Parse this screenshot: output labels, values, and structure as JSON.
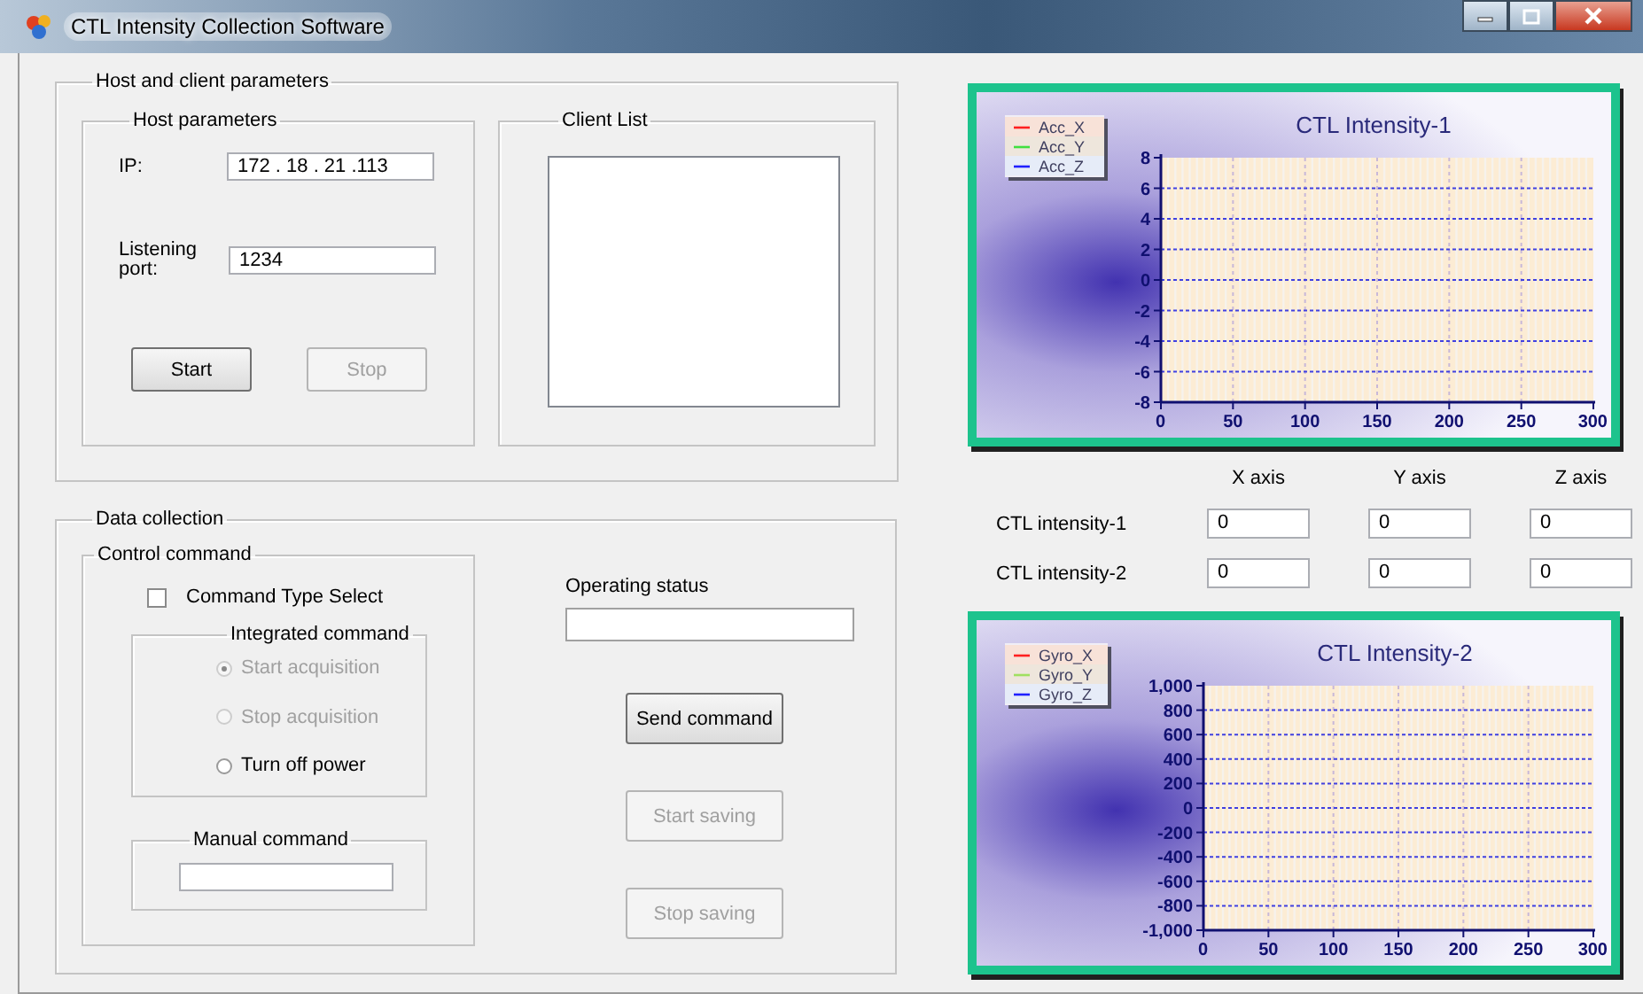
{
  "window": {
    "title": "CTL Intensity Collection Software"
  },
  "host_client": {
    "title": "Host and client parameters",
    "host": {
      "title": "Host parameters",
      "ip_label": "IP:",
      "ip_value": "172 . 18 . 21 .113",
      "port_label": "Listening port:",
      "port_value": "1234",
      "buttons": [
        {
          "label": "Start",
          "disabled": false
        },
        {
          "label": "Stop",
          "disabled": true
        }
      ]
    },
    "client_list": {
      "title": "Client List"
    }
  },
  "data_collection": {
    "title": "Data collection",
    "control_command": {
      "title": "Control command",
      "checkbox": {
        "label": "Command Type Select",
        "checked": false
      },
      "integrated": {
        "title": "Integrated command",
        "options": [
          {
            "label": "Start acquisition",
            "selected": true,
            "disabled": true
          },
          {
            "label": "Stop acquisition",
            "selected": false,
            "disabled": true
          },
          {
            "label": "Turn off power",
            "selected": false,
            "disabled": false
          }
        ]
      },
      "manual": {
        "title": "Manual command"
      }
    },
    "status": {
      "label": "Operating status"
    },
    "buttons": [
      {
        "label": "Send command",
        "disabled": false
      },
      {
        "label": "Start saving",
        "disabled": true
      },
      {
        "label": "Stop saving",
        "disabled": true
      }
    ]
  },
  "charts": [
    {
      "chart_data": {
        "type": "line",
        "title": "CTL Intensity-1",
        "series": [
          {
            "name": "Acc_X",
            "color": "#ff2020",
            "values": [
              null,
              null,
              null,
              null,
              null,
              null,
              null
            ]
          },
          {
            "name": "Acc_Y",
            "color": "#40e040",
            "values": [
              null,
              null,
              null,
              null,
              null,
              null,
              null
            ]
          },
          {
            "name": "Acc_Z",
            "color": "#2020ff",
            "values": [
              null,
              null,
              null,
              null,
              null,
              null,
              null
            ]
          }
        ],
        "categories": [
          "0",
          "50",
          "100",
          "150",
          "200",
          "250",
          "300"
        ],
        "ylim": [
          -8,
          8
        ],
        "yticks": [
          -8,
          -6,
          -4,
          -2,
          0,
          2,
          4,
          6,
          8
        ],
        "grid": true
      }
    },
    {
      "chart_data": {
        "type": "line",
        "title": "CTL Intensity-2",
        "series": [
          {
            "name": "Gyro_X",
            "color": "#ff2020",
            "values": [
              null,
              null,
              null,
              null,
              null,
              null,
              null
            ]
          },
          {
            "name": "Gyro_Y",
            "color": "#a0e060",
            "values": [
              null,
              null,
              null,
              null,
              null,
              null,
              null
            ]
          },
          {
            "name": "Gyro_Z",
            "color": "#2020ff",
            "values": [
              null,
              null,
              null,
              null,
              null,
              null,
              null
            ]
          }
        ],
        "categories": [
          "0",
          "50",
          "100",
          "150",
          "200",
          "250",
          "300"
        ],
        "ylim": [
          -1000,
          1000
        ],
        "grid": true,
        "yticks": [
          {
            "value": -1000,
            "label": "-1,000"
          },
          -800,
          -600,
          -400,
          -200,
          0,
          200,
          400,
          600,
          800,
          {
            "value": 1000,
            "label": "1,000"
          }
        ]
      }
    }
  ],
  "readings": {
    "columns": [
      "X axis",
      "Y axis",
      "Z axis"
    ],
    "rows": [
      {
        "label": "CTL intensity-1",
        "values": [
          "0",
          "0",
          "0"
        ]
      },
      {
        "label": "CTL intensity-2",
        "values": [
          "0",
          "0",
          "0"
        ]
      }
    ]
  }
}
